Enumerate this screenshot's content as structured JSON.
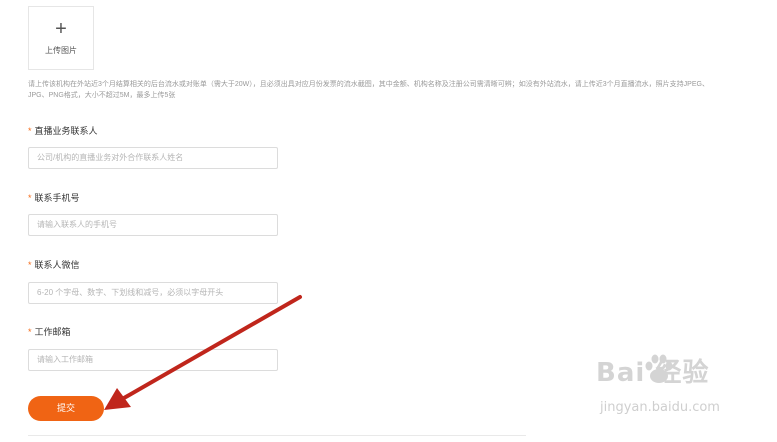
{
  "upload": {
    "plus": "+",
    "label": "上传图片"
  },
  "helper_text": "请上传该机构在外站近3个月结算相关的后台流水或对账单（需大于20W），且必须出具对应月份发票的流水截图，其中金额、机构名称及注册公司需清晰可辨；如没有外站流水，请上传近3个月直播流水，照片支持JPEG、JPG、PNG格式，大小不超过5M，最多上传5张",
  "fields": [
    {
      "required_mark": "*",
      "label": "直播业务联系人",
      "placeholder": "公司/机构的直播业务对外合作联系人姓名"
    },
    {
      "required_mark": "*",
      "label": "联系手机号",
      "placeholder": "请输入联系人的手机号"
    },
    {
      "required_mark": "*",
      "label": "联系人微信",
      "placeholder": "6-20 个字母、数字、下划线和减号，必须以字母开头"
    },
    {
      "required_mark": "*",
      "label": "工作邮箱",
      "placeholder": "请输入工作邮箱"
    }
  ],
  "submit_label": "提交",
  "watermark": {
    "brand": "Bai  经验",
    "url": "jingyan.baidu.com"
  },
  "colors": {
    "accent": "#f06414",
    "arrow": "#c0261c"
  }
}
